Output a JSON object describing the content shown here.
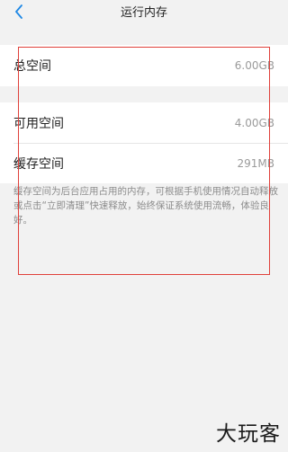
{
  "header": {
    "title": "运行内存",
    "back_icon": "chevron-left-icon"
  },
  "memory": {
    "total_label": "总空间",
    "total_value": "6.00GB",
    "available_label": "可用空间",
    "available_value": "4.00GB",
    "cache_label": "缓存空间",
    "cache_value": "291MB"
  },
  "note": "缓存空间为后台应用占用的内存，可根据手机使用情况自动释放或点击“立即清理”快速释放，始终保证系统使用流畅，体验良好。",
  "watermark": "大玩客",
  "colors": {
    "accent": "#1e88e5",
    "highlight": "#e0403a",
    "background": "#f2f2f2"
  }
}
